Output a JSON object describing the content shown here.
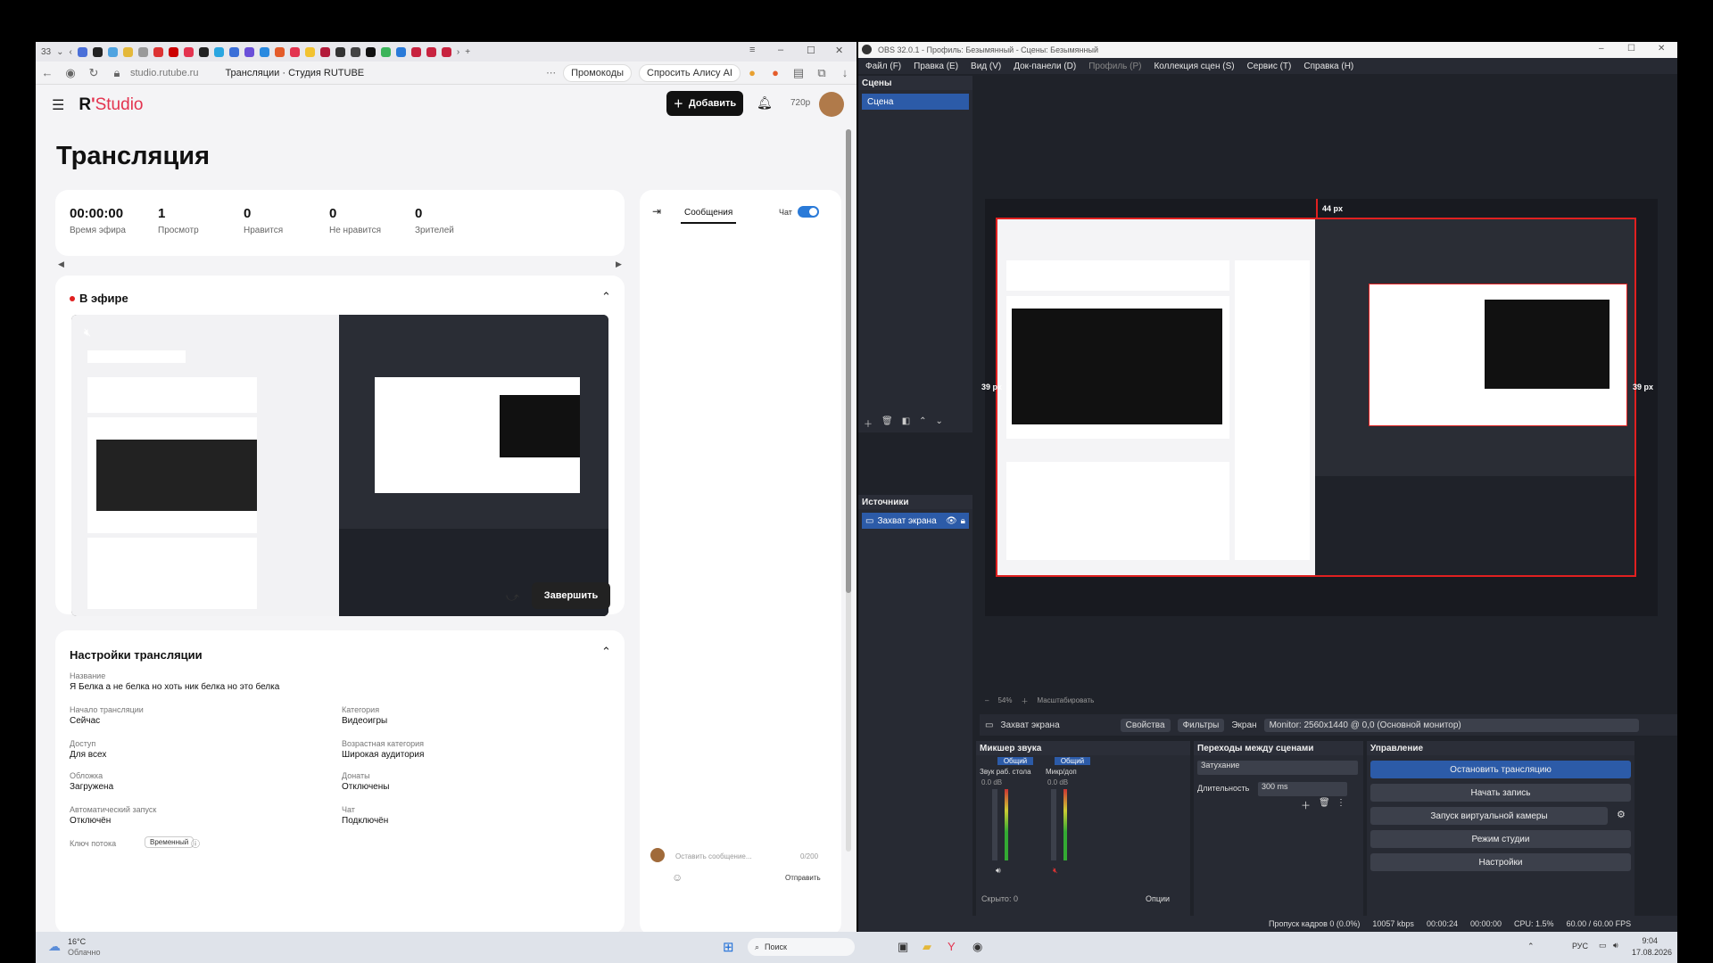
{
  "browser": {
    "tab_count": "33",
    "address": "studio.rutube.ru",
    "page_title": "Трансляции · Студия RUTUBE",
    "promo_label": "Промокоды",
    "alisa_label": "Спросить Алису AI"
  },
  "header": {
    "logo_r": "R",
    "logo_apostrophe": "'",
    "logo_studio": "Studio",
    "add_button": "Добавить",
    "quality": "720p"
  },
  "page": {
    "title": "Трансляция"
  },
  "stats": [
    {
      "value": "00:00:00",
      "label": "Время эфира"
    },
    {
      "value": "1",
      "label": "Просмотр"
    },
    {
      "value": "0",
      "label": "Нравится"
    },
    {
      "value": "0",
      "label": "Не нравится"
    },
    {
      "value": "0",
      "label": "Зрителей"
    }
  ],
  "live": {
    "title": "В эфире",
    "finish_button": "Завершить"
  },
  "chat": {
    "tab_messages": "Сообщения",
    "chat_toggle": "Чат",
    "input_placeholder": "Оставить сообщение...",
    "counter": "0/200",
    "send_button": "Отправить"
  },
  "settings": {
    "title": "Настройки трансляции",
    "name_label": "Название",
    "name_value": "Я Белка а не белка но хоть ник белка но это белка",
    "start_label": "Начало трансляции",
    "start_value": "Сейчас",
    "category_label": "Категория",
    "category_value": "Видеоигры",
    "access_label": "Доступ",
    "access_value": "Для всех",
    "age_label": "Возрастная категория",
    "age_value": "Широкая аудитория",
    "cover_label": "Обложка",
    "cover_value": "Загружена",
    "donate_label": "Донаты",
    "donate_value": "Отключены",
    "autostart_label": "Автоматический запуск",
    "autostart_value": "Отключён",
    "chat_label": "Чат",
    "chat_value": "Подключён",
    "key_label": "Ключ потока",
    "key_badge": "Временный"
  },
  "obs": {
    "title": "OBS 32.0.1 - Профиль: Безымянный - Сцены: Безымянный",
    "menu": [
      "Файл (F)",
      "Правка (E)",
      "Вид (V)",
      "Док-панели (D)",
      "Профиль (P)",
      "Коллекция сцен (S)",
      "Сервис (T)",
      "Справка (H)"
    ],
    "scenes_title": "Сцены",
    "scene_item": "Сцена",
    "sources_title": "Источники",
    "source_item": "Захват экрана",
    "guide_top": "44 px",
    "guide_left": "39 px",
    "guide_right": "39 px",
    "zoom": "54%",
    "zoom_mode": "Масштабировать",
    "source_bar_name": "Захват экрана",
    "properties_button": "Свойства",
    "filters_button": "Фильтры",
    "screen_label": "Экран",
    "monitor_value": "Monitor: 2560x1440 @ 0,0 (Основной монитор)",
    "mixer_title": "Микшер звука",
    "mixer_ch1_tag": "Общий",
    "mixer_ch1_name": "Звук раб. стола",
    "mixer_ch1_db": "0.0 dB",
    "mixer_ch2_tag": "Общий",
    "mixer_ch2_name": "Микр/доп",
    "mixer_ch2_db": "0.0 dB",
    "hidden_label": "Скрыто: 0",
    "options_label": "Опции",
    "transitions_title": "Переходы между сценами",
    "transition_value": "Затухание",
    "duration_label": "Длительность",
    "duration_value": "300 ms",
    "controls_title": "Управление",
    "stop_stream": "Остановить трансляцию",
    "start_record": "Начать запись",
    "virtual_cam": "Запуск виртуальной камеры",
    "studio_mode": "Режим студии",
    "settings_button": "Настройки",
    "status_dropped": "Пропуск кадров 0 (0.0%)",
    "status_kbps": "10057 kbps",
    "status_live_time": "00:00:24",
    "status_rec_time": "00:00:00",
    "status_cpu": "CPU: 1.5%",
    "status_fps": "60.00 / 60.00 FPS"
  },
  "taskbar": {
    "weather_temp": "16°C",
    "weather_desc": "Облачно",
    "search": "Поиск",
    "lang": "РУС",
    "time": "9:04",
    "date": "17.08.2026"
  },
  "colors": {
    "accent": "#e3334f",
    "obs_blue": "#2c5ba8",
    "live_red": "#e02020"
  }
}
